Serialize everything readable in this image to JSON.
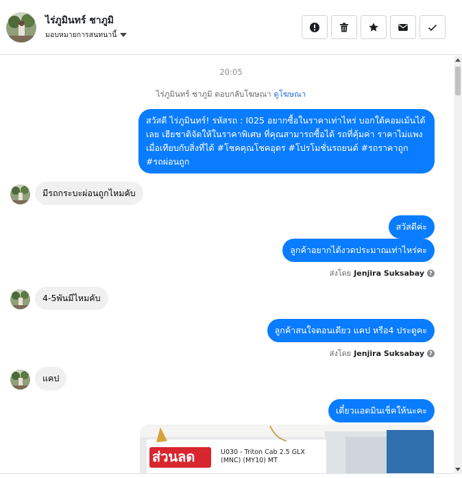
{
  "header": {
    "name": "ไร่ภูมินทร์ ชาภูมิ",
    "subtitle": "มอบหมายการสนทนานี้",
    "actions": [
      {
        "icon": "alert-circle-icon"
      },
      {
        "icon": "trash-icon"
      },
      {
        "icon": "star-icon"
      },
      {
        "icon": "mail-icon"
      },
      {
        "icon": "check-icon"
      }
    ]
  },
  "chat": {
    "timestamp": "20:05",
    "reply_notice": "ไร่ภูมินทร์ ชาภูมิ ตอบกลับโฆษณา",
    "reply_link": "ดูโฆษณา",
    "messages": [
      {
        "side": "out",
        "text": "สวัสดี ไร่ภูมินทร์! รหัสรถ : I025 อยากซื้อในราคาเท่าไหร่ บอกใต้คอมเม้นได้เลย เฮียชาติจัดให้ในราคาพิเศษ ที่คุณสามารถซื้อได้ รถที่คุ้มค่า ราคาไม่แพง เมื่อเทียบกับสิ่งที่ได้ #โชคคุณโชคอุดร #โปรโมชั่นรถยนต์ #รถราคาถูก #รถผ่อนถูก"
      },
      {
        "side": "in",
        "text": "มีรถกระบะผ่อนถูกไหมคับ"
      },
      {
        "side": "out",
        "text": "สวัสดีค่ะ"
      },
      {
        "side": "out",
        "text": "ลูกค้าอยากได้งวดประมาณเท่าไหร่คะ"
      },
      {
        "side": "in",
        "text": "4-5พันมีไหมคับ"
      },
      {
        "side": "out",
        "text": "ลูกค้าสนใจตอนเดียว แคป หรือ4 ประตูคะ"
      },
      {
        "side": "in",
        "text": "แคป"
      },
      {
        "side": "out",
        "text": "เดี๋ยวแอดมินเช็คให้นะคะ"
      }
    ],
    "sent_by_label": "ส่งโดย",
    "sent_by_name": "Jenjira Suksabay"
  },
  "ad_card": {
    "badge": "ส่วนลด",
    "model_line1": "U030 - Triton Cab 2.5 GLX",
    "model_line2": "(MNC) (MY10) MT"
  },
  "colors": {
    "outgoing": "#0a7cff",
    "incoming": "#f0f0f0",
    "link": "#216fdb",
    "badge_red": "#d8262e"
  }
}
